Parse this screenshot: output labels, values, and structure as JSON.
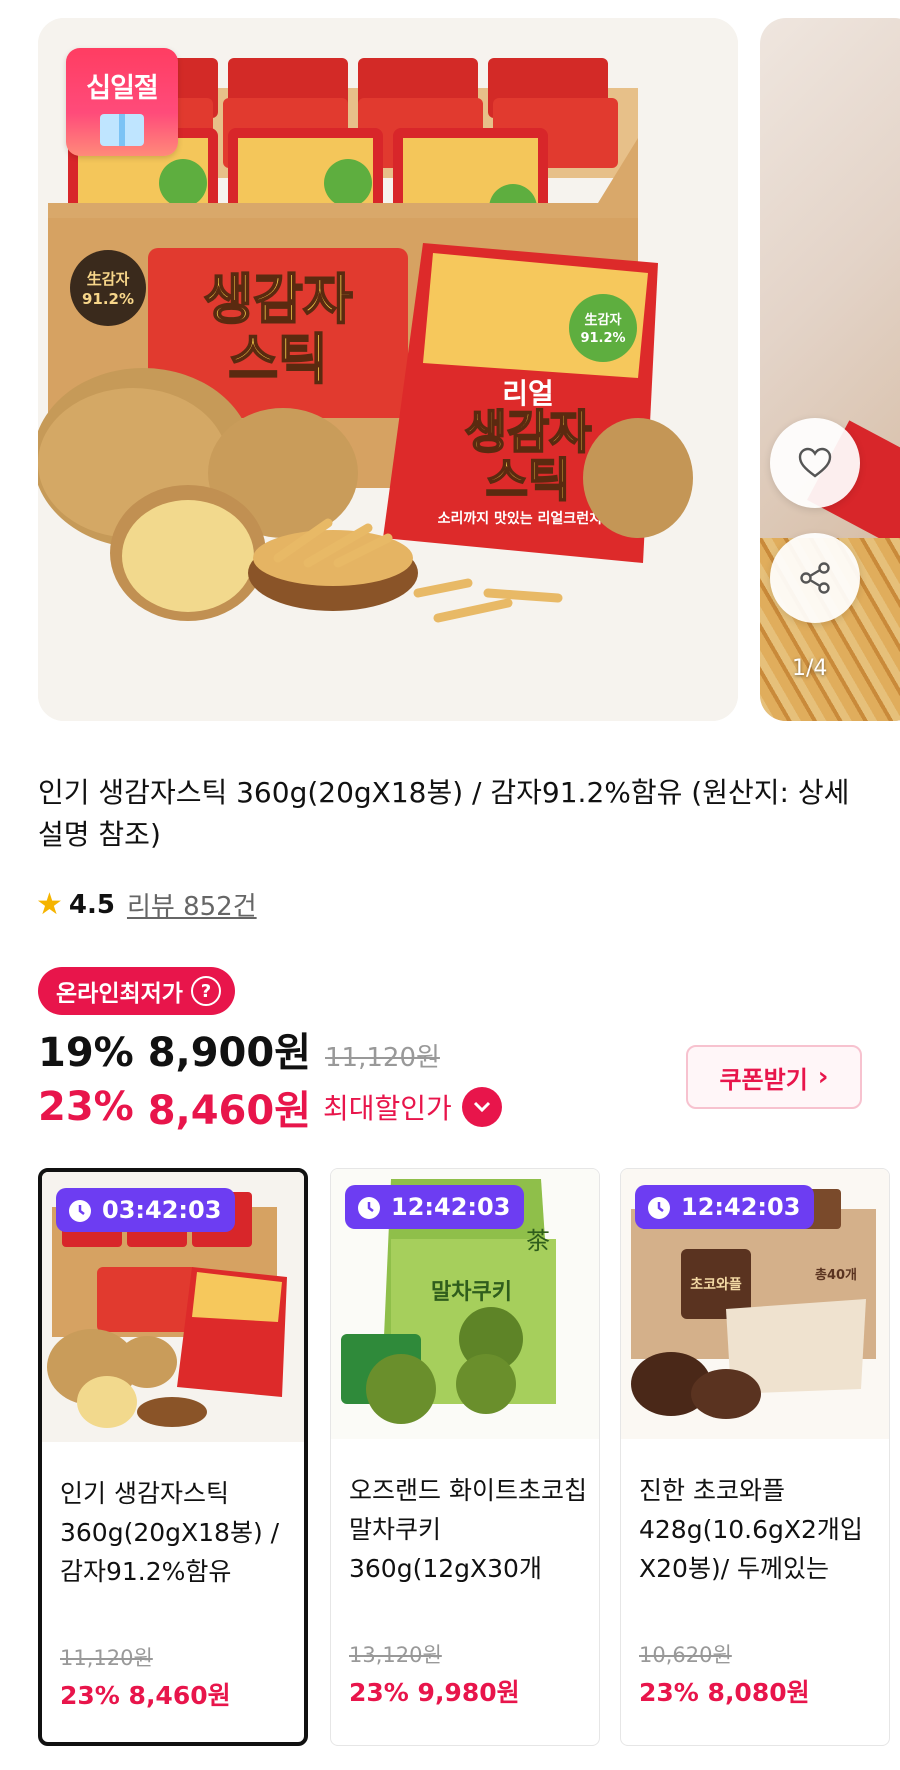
{
  "carousel": {
    "sticker_text": "십일절",
    "pager": "1/4",
    "heart_icon": "heart-icon",
    "share_icon": "share-icon",
    "product_pack_text": {
      "brand": "리얼",
      "name_line1": "생감자",
      "name_line2": "스틱",
      "badge_line1": "生감자",
      "badge_line2": "91.2%",
      "slogan": "소리까지 맛있는 리얼크런치!"
    }
  },
  "product": {
    "title": "인기 생감자스틱 360g(20gX18봉) / 감자91.2%함유 (원산지: 상세설명 참조)",
    "rating": "4.5",
    "reviews": "리뷰 852건"
  },
  "pricing": {
    "badge": "온라인최저가",
    "badge_help": "?",
    "discount1": "19%",
    "price1": "8,900원",
    "original": "11,120원",
    "discount2": "23%",
    "price2": "8,460원",
    "max_discount_label": "최대할인가",
    "coupon_label": "쿠폰받기"
  },
  "deals": [
    {
      "timer": "03:42:03",
      "name": "인기 생감자스틱 360g(20gX18봉) / 감자91.2%함유",
      "original": "11,120원",
      "sale": "23% 8,460원"
    },
    {
      "timer": "12:42:03",
      "name": "오즈랜드 화이트초코칩 말차쿠키 360g(12gX30개",
      "original": "13,120원",
      "sale": "23% 9,980원",
      "pack_label": "말차쿠키",
      "pack_tag": "茶"
    },
    {
      "timer": "12:42:03",
      "name": "진한 초코와플 428g(10.6gX2개입X20봉)/ 두께있는",
      "original": "10,620원",
      "sale": "23% 8,080원",
      "pack_label": "초코와플",
      "pack_count": "총40개"
    }
  ],
  "colors": {
    "accent": "#e8154b",
    "timer": "#6d3df2",
    "star": "#f5b400"
  }
}
